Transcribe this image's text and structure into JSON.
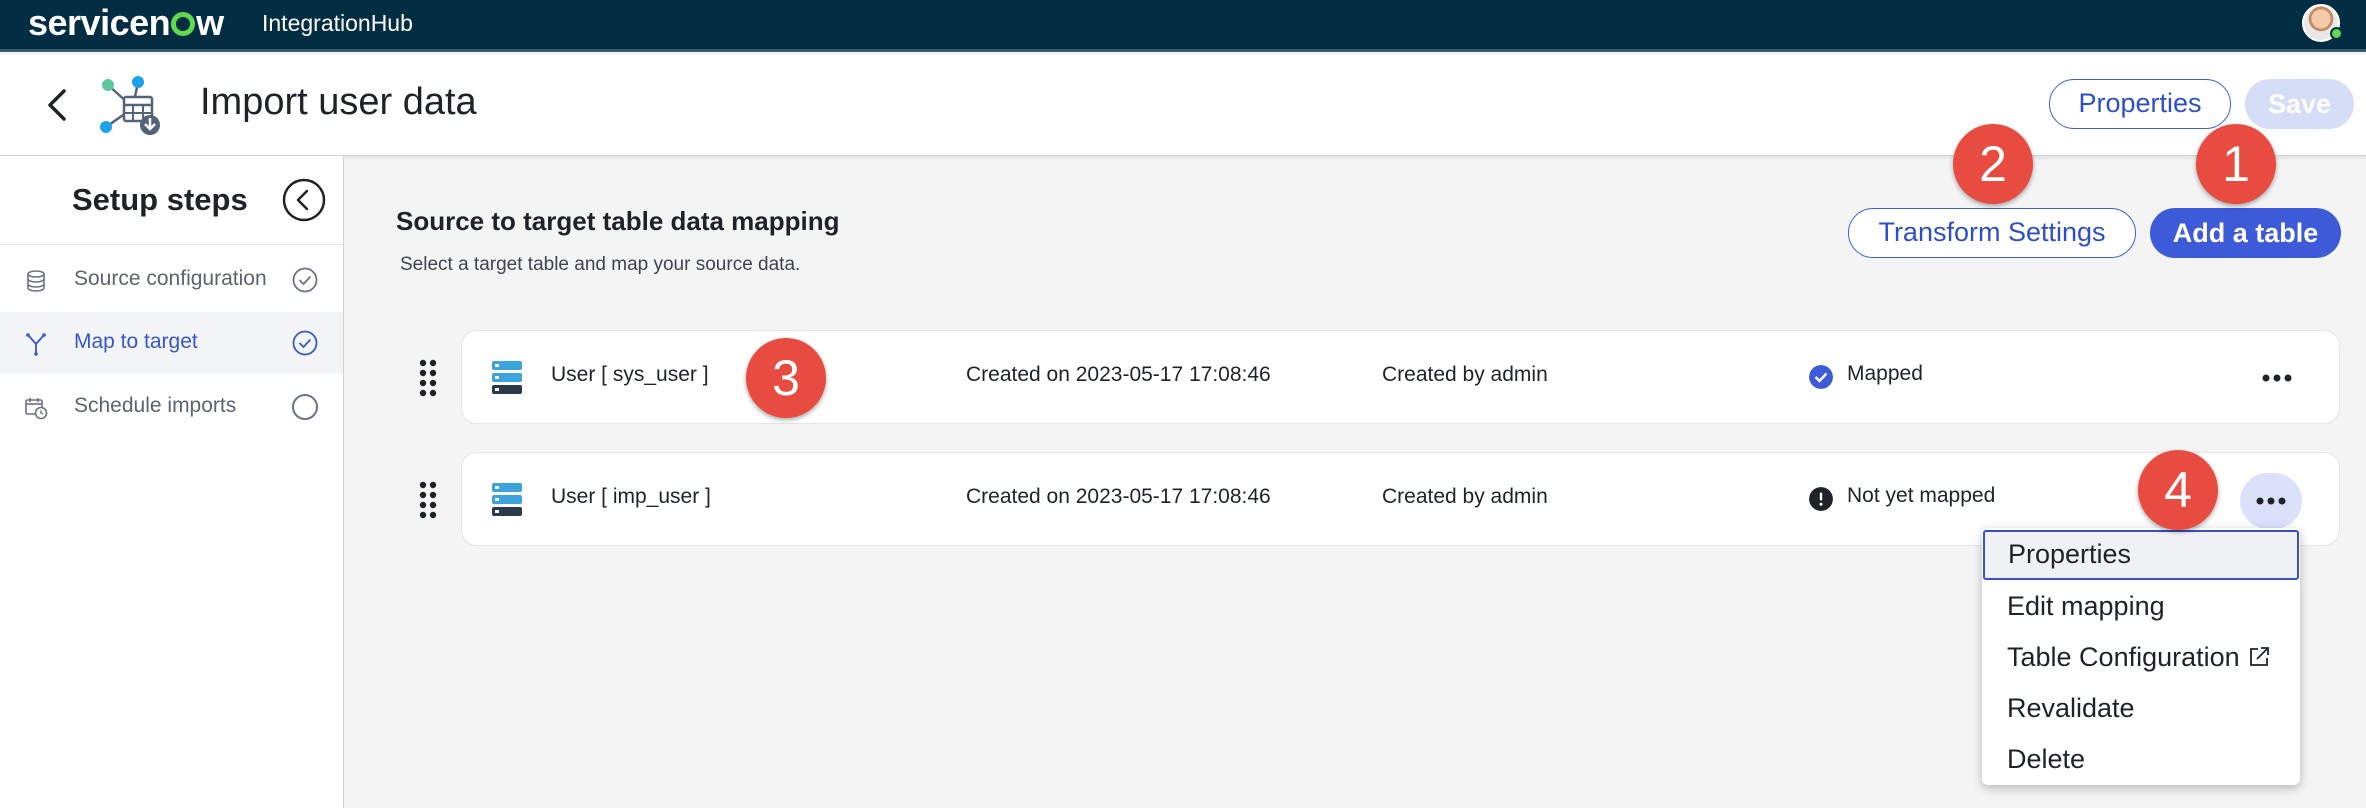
{
  "topbar": {
    "brand": "servicenow",
    "product": "IntegrationHub"
  },
  "header": {
    "title": "Import user data",
    "properties_label": "Properties",
    "save_label": "Save"
  },
  "sidebar": {
    "title": "Setup steps",
    "steps": [
      {
        "label": "Source configuration",
        "icon": "database-icon",
        "active": false,
        "status": "complete"
      },
      {
        "label": "Map to target",
        "icon": "merge-icon",
        "active": true,
        "status": "complete"
      },
      {
        "label": "Schedule imports",
        "icon": "calendar-clock-icon",
        "active": false,
        "status": "pending"
      }
    ]
  },
  "main": {
    "title": "Source to target table data mapping",
    "subtitle": "Select a target table and map your source data.",
    "transform_label": "Transform Settings",
    "add_table_label": "Add a table",
    "rows": [
      {
        "name": "User [ sys_user ]",
        "created": "Created on 2023-05-17 17:08:46",
        "creator": "Created by admin",
        "status": "Mapped",
        "status_color": "#3d5ad9"
      },
      {
        "name": "User [ imp_user ]",
        "created": "Created on 2023-05-17 17:08:46",
        "creator": "Created by admin",
        "status": "Not yet mapped",
        "status_color": "#1f2328"
      }
    ]
  },
  "menu": {
    "items": [
      "Properties",
      "Edit mapping",
      "Table Configuration",
      "Revalidate",
      "Delete"
    ]
  },
  "badges": [
    "1",
    "2",
    "3",
    "4"
  ],
  "colors": {
    "accent": "#3d5ad9",
    "topbar": "#032d42",
    "badge": "#e84b3f"
  }
}
